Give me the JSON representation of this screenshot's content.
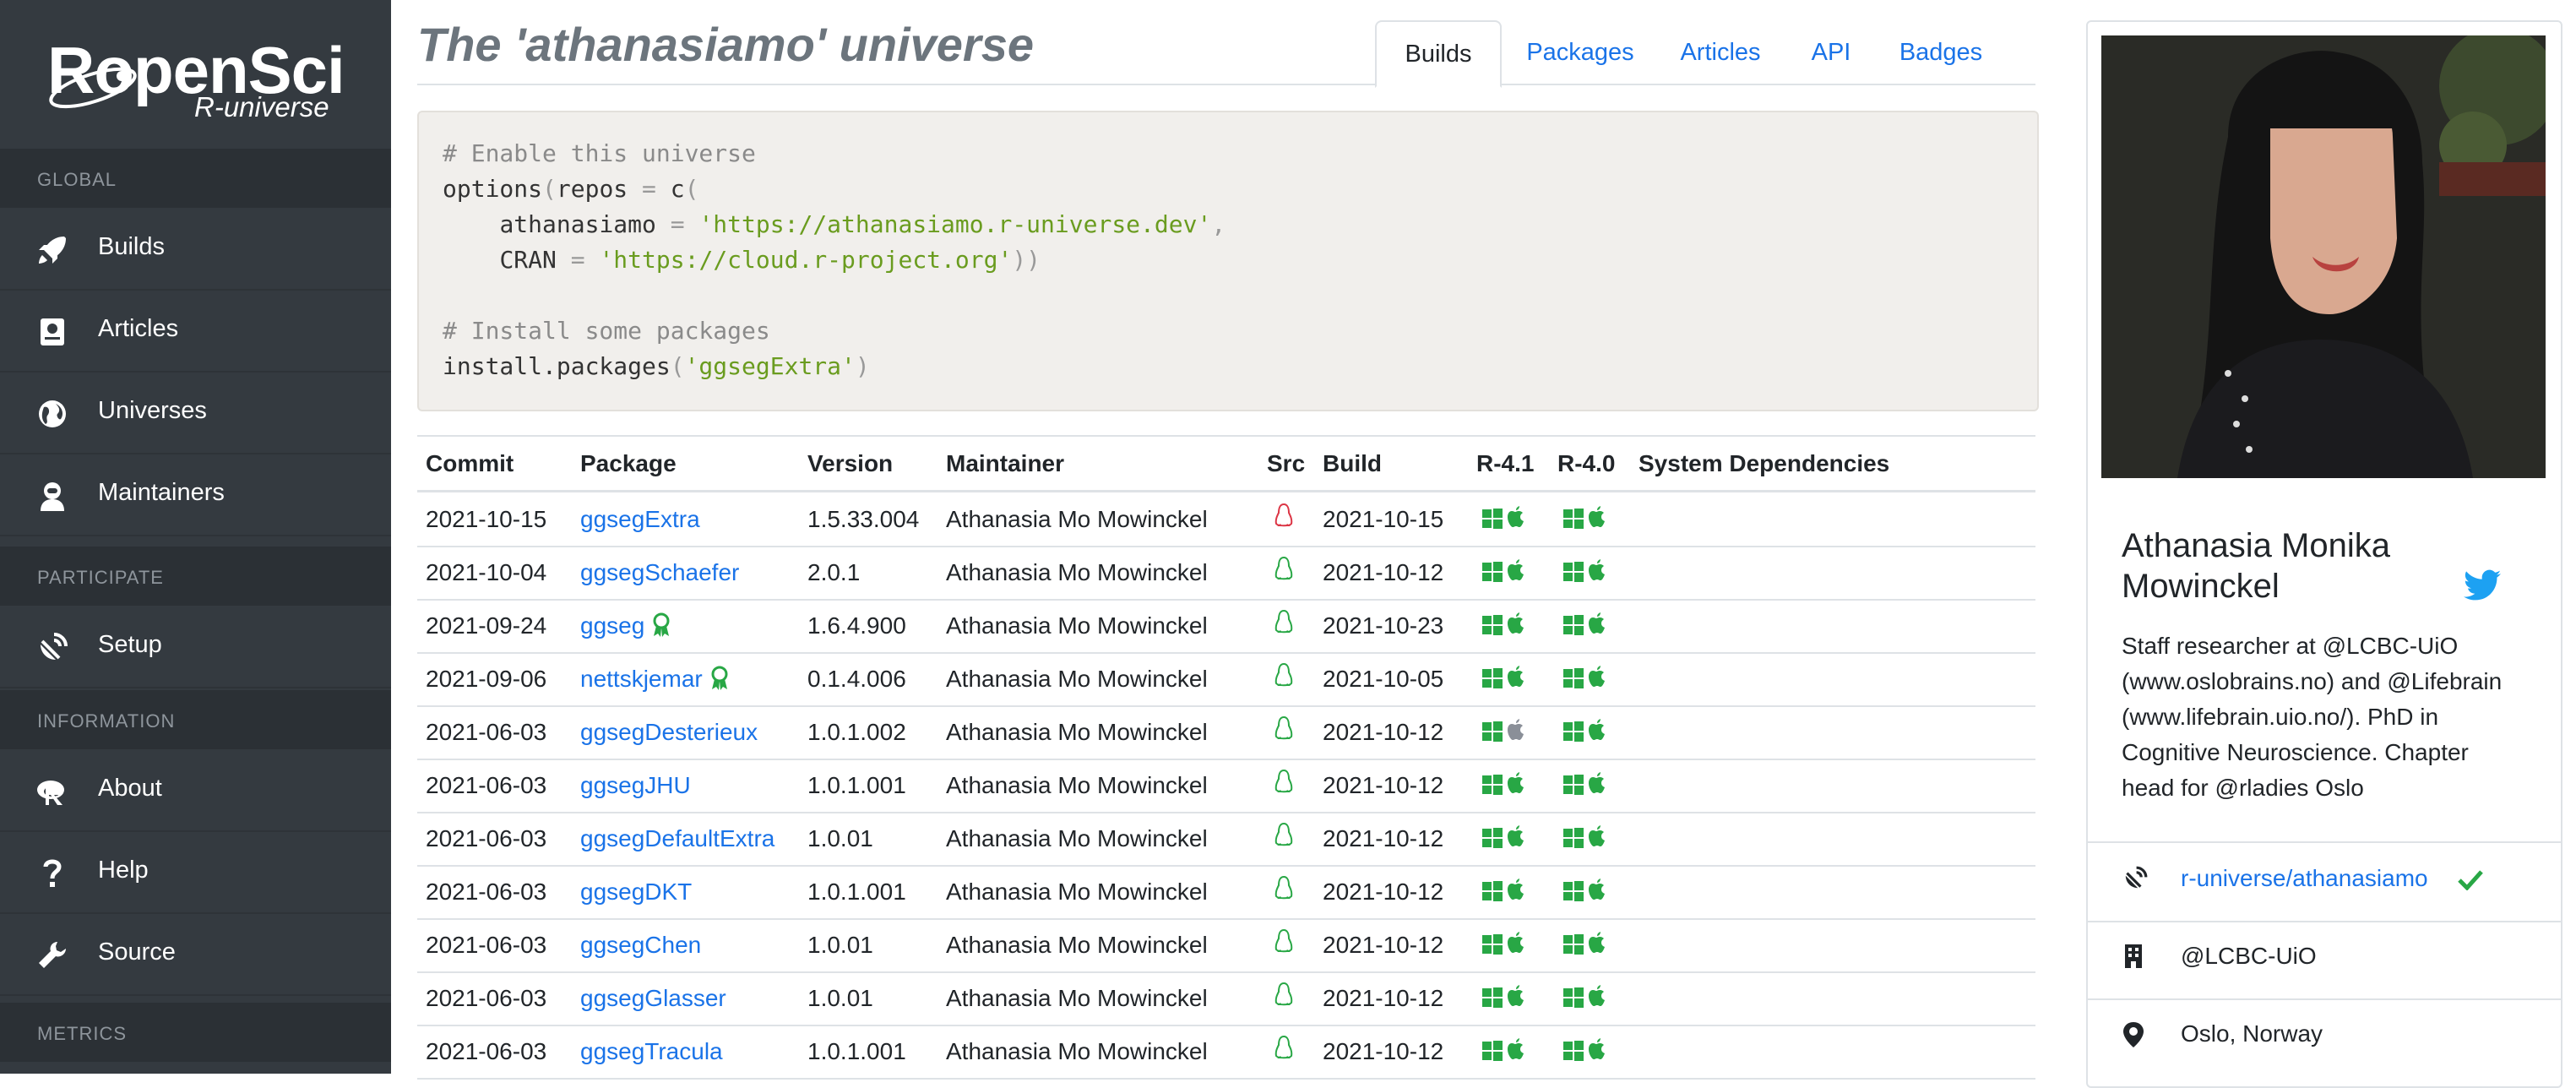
{
  "sidebar": {
    "logo_text": "RopenSci",
    "logo_subtitle": "R-universe",
    "sections": {
      "global": "GLOBAL",
      "participate": "PARTICIPATE",
      "information": "INFORMATION",
      "metrics": "METRICS"
    },
    "items": {
      "builds": "Builds",
      "articles": "Articles",
      "universes": "Universes",
      "maintainers": "Maintainers",
      "setup": "Setup",
      "about": "About",
      "help": "Help",
      "source": "Source"
    }
  },
  "header": {
    "title": "The 'athanasiamo' universe",
    "tabs": [
      "Builds",
      "Packages",
      "Articles",
      "API",
      "Badges"
    ],
    "active_tab": "Builds"
  },
  "code": {
    "comment1": "# Enable this universe",
    "line2_a": "options",
    "line2_b": "(",
    "line2_c": "repos",
    "line2_d": " = ",
    "line2_e": "c",
    "line2_f": "(",
    "line3_key": "athanasiamo",
    "line3_eq": " = ",
    "line3_val": "'https://athanasiamo.r-universe.dev'",
    "line3_comma": ",",
    "line4_key": "CRAN",
    "line4_eq": " = ",
    "line4_val": "'https://cloud.r-project.org'",
    "line4_close": "))",
    "comment2": "# Install some packages",
    "line6_fn": "install.packages",
    "line6_open": "(",
    "line6_val": "'ggsegExtra'",
    "line6_close": ")"
  },
  "table": {
    "headers": {
      "commit": "Commit",
      "package": "Package",
      "version": "Version",
      "maintainer": "Maintainer",
      "src": "Src",
      "build": "Build",
      "r41": "R-4.1",
      "r40": "R-4.0",
      "sysdeps": "System Dependencies"
    },
    "rows": [
      {
        "commit": "2021-10-15",
        "package": "ggsegExtra",
        "version": "1.5.33.004",
        "maintainer": "Athanasia Mo Mowinckel",
        "build": "2021-10-15",
        "src_status": "fail",
        "award": false,
        "r41_mac": "ok"
      },
      {
        "commit": "2021-10-04",
        "package": "ggsegSchaefer",
        "version": "2.0.1",
        "maintainer": "Athanasia Mo Mowinckel",
        "build": "2021-10-12",
        "src_status": "ok",
        "award": false,
        "r41_mac": "ok"
      },
      {
        "commit": "2021-09-24",
        "package": "ggseg",
        "version": "1.6.4.900",
        "maintainer": "Athanasia Mo Mowinckel",
        "build": "2021-10-23",
        "src_status": "ok",
        "award": true,
        "r41_mac": "ok"
      },
      {
        "commit": "2021-09-06",
        "package": "nettskjemar",
        "version": "0.1.4.006",
        "maintainer": "Athanasia Mo Mowinckel",
        "build": "2021-10-05",
        "src_status": "ok",
        "award": true,
        "r41_mac": "ok"
      },
      {
        "commit": "2021-06-03",
        "package": "ggsegDesterieux",
        "version": "1.0.1.002",
        "maintainer": "Athanasia Mo Mowinckel",
        "build": "2021-10-12",
        "src_status": "ok",
        "award": false,
        "r41_mac": "na"
      },
      {
        "commit": "2021-06-03",
        "package": "ggsegJHU",
        "version": "1.0.1.001",
        "maintainer": "Athanasia Mo Mowinckel",
        "build": "2021-10-12",
        "src_status": "ok",
        "award": false,
        "r41_mac": "ok"
      },
      {
        "commit": "2021-06-03",
        "package": "ggsegDefaultExtra",
        "version": "1.0.01",
        "maintainer": "Athanasia Mo Mowinckel",
        "build": "2021-10-12",
        "src_status": "ok",
        "award": false,
        "r41_mac": "ok"
      },
      {
        "commit": "2021-06-03",
        "package": "ggsegDKT",
        "version": "1.0.1.001",
        "maintainer": "Athanasia Mo Mowinckel",
        "build": "2021-10-12",
        "src_status": "ok",
        "award": false,
        "r41_mac": "ok"
      },
      {
        "commit": "2021-06-03",
        "package": "ggsegChen",
        "version": "1.0.01",
        "maintainer": "Athanasia Mo Mowinckel",
        "build": "2021-10-12",
        "src_status": "ok",
        "award": false,
        "r41_mac": "ok"
      },
      {
        "commit": "2021-06-03",
        "package": "ggsegGlasser",
        "version": "1.0.01",
        "maintainer": "Athanasia Mo Mowinckel",
        "build": "2021-10-12",
        "src_status": "ok",
        "award": false,
        "r41_mac": "ok"
      },
      {
        "commit": "2021-06-03",
        "package": "ggsegTracula",
        "version": "1.0.1.001",
        "maintainer": "Athanasia Mo Mowinckel",
        "build": "2021-10-12",
        "src_status": "ok",
        "award": false,
        "r41_mac": "ok"
      }
    ]
  },
  "profile": {
    "name": "Athanasia Monika Mowinckel",
    "bio": "Staff researcher at @LCBC-UiO (www.oslobrains.no) and @Lifebrain (www.lifebrain.uio.no/). PhD in Cognitive Neuroscience. Chapter head for @rladies Oslo",
    "universe_link": "r-universe/athanasiamo",
    "org": "@LCBC-UiO",
    "location": "Oslo, Norway"
  },
  "colors": {
    "sidebar_bg": "#343a40",
    "link": "#1a73e8",
    "ok_green": "#28a745",
    "fail_red": "#dc3545",
    "na_gray": "#8a8f98",
    "twitter_blue": "#1da1f2"
  }
}
